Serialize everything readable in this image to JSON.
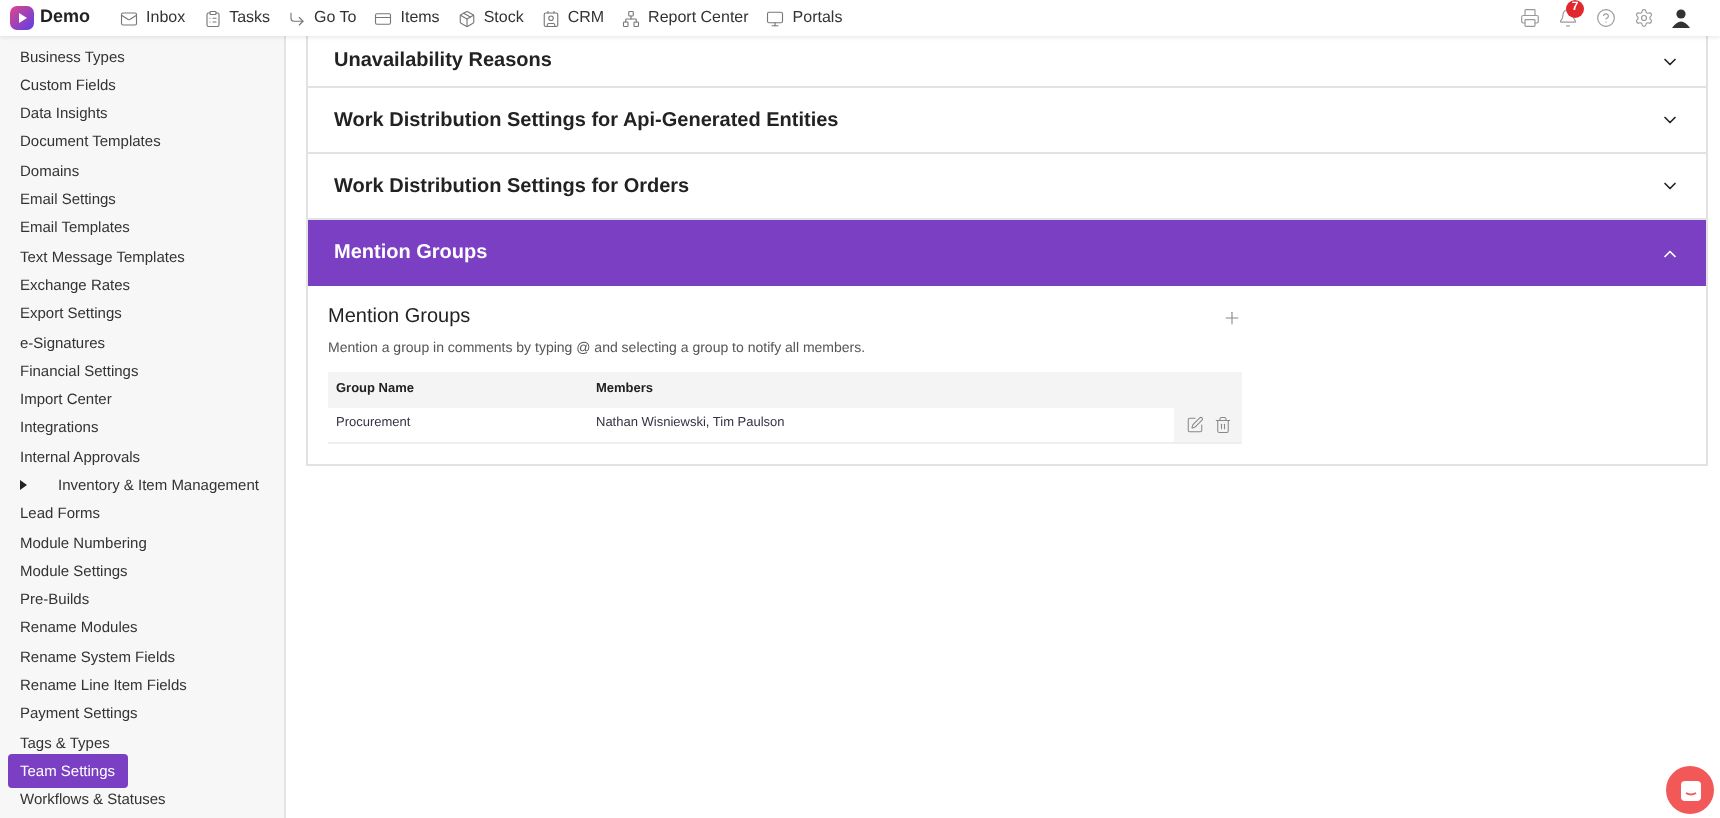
{
  "brand": "Demo",
  "nav": [
    {
      "label": "Inbox"
    },
    {
      "label": "Tasks"
    },
    {
      "label": "Go To"
    },
    {
      "label": "Items"
    },
    {
      "label": "Stock"
    },
    {
      "label": "CRM"
    },
    {
      "label": "Report Center"
    },
    {
      "label": "Portals"
    }
  ],
  "notification_count": "7",
  "sidebar": {
    "items": [
      {
        "label": "Business Types",
        "selected": false
      },
      {
        "label": "Custom Fields",
        "selected": false
      },
      {
        "label": "Data Insights",
        "selected": false
      },
      {
        "label": "Document Templates",
        "selected": false
      },
      {
        "label": "Domains",
        "selected": false
      },
      {
        "label": "Email Settings",
        "selected": false
      },
      {
        "label": "Email Templates",
        "selected": false
      },
      {
        "label": "Text Message Templates",
        "selected": false
      },
      {
        "label": "Exchange Rates",
        "selected": false
      },
      {
        "label": "Export Settings",
        "selected": false
      },
      {
        "label": "e-Signatures",
        "selected": false
      },
      {
        "label": "Financial Settings",
        "selected": false
      },
      {
        "label": "Import Center",
        "selected": false
      },
      {
        "label": "Integrations",
        "selected": false
      },
      {
        "label": "Internal Approvals",
        "selected": false
      },
      {
        "label": "Inventory & Item Management",
        "selected": false,
        "expanded": false
      },
      {
        "label": "Lead Forms",
        "selected": false
      },
      {
        "label": "Module Numbering",
        "selected": false
      },
      {
        "label": "Module Settings",
        "selected": false
      },
      {
        "label": "Pre-Builds",
        "selected": false
      },
      {
        "label": "Rename Modules",
        "selected": false
      },
      {
        "label": "Rename System Fields",
        "selected": false
      },
      {
        "label": "Rename Line Item Fields",
        "selected": false
      },
      {
        "label": "Payment Settings",
        "selected": false
      },
      {
        "label": "Tags & Types",
        "selected": false
      },
      {
        "label": "Team Settings",
        "selected": true
      },
      {
        "label": "Workflows & Statuses",
        "selected": false
      }
    ]
  },
  "sections": [
    {
      "title": "Unavailability Reasons",
      "expanded": false
    },
    {
      "title": "Work Distribution Settings for Api-Generated Entities",
      "expanded": false
    },
    {
      "title": "Work Distribution Settings for Orders",
      "expanded": false
    },
    {
      "title": "Mention Groups",
      "expanded": true
    }
  ],
  "mention_groups": {
    "title": "Mention Groups",
    "description": "Mention a group in comments by typing @ and selecting a group to notify all members.",
    "columns": [
      "Group Name",
      "Members"
    ],
    "rows": [
      {
        "group_name": "Procurement",
        "members": "Nathan Wisniewski, Tim Paulson"
      }
    ]
  }
}
